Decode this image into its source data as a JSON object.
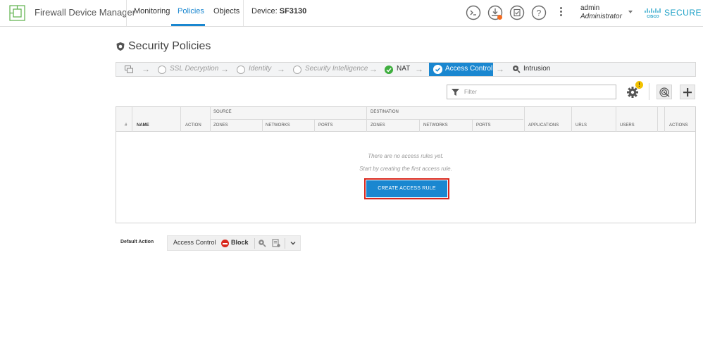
{
  "app": {
    "title": "Firewall Device Manager"
  },
  "nav": {
    "tabs": [
      {
        "label": "Monitoring"
      },
      {
        "label": "Policies"
      },
      {
        "label": "Objects"
      }
    ],
    "active_tab": "Policies",
    "device_prefix": "Device:",
    "device_name": "SF3130"
  },
  "top_icons": [
    "cli-console-icon",
    "deploy-icon",
    "task-list-icon",
    "help-icon",
    "more-options-icon"
  ],
  "user": {
    "name": "admin",
    "role": "Administrator"
  },
  "brand": {
    "secure_text": "SECURE",
    "secure_color": "#1a9fc6"
  },
  "page": {
    "title": "Security Policies"
  },
  "policy_steps": [
    {
      "label": "SSL Decryption",
      "status": "not-configured"
    },
    {
      "label": "Identity",
      "status": "not-configured"
    },
    {
      "label": "Security Intelligence",
      "status": "not-configured"
    },
    {
      "label": "NAT",
      "status": "configured"
    },
    {
      "label": "Access Control",
      "status": "active"
    },
    {
      "label": "Intrusion",
      "status": "available"
    }
  ],
  "filter": {
    "placeholder": "Filter"
  },
  "toolbar": {
    "settings_badge": "!"
  },
  "table": {
    "group_headers": {
      "source": "SOURCE",
      "destination": "DESTINATION"
    },
    "columns": {
      "number": "#",
      "name": "NAME",
      "action": "ACTION",
      "src_zones": "ZONES",
      "src_networks": "NETWORKS",
      "src_ports": "PORTS",
      "dst_zones": "ZONES",
      "dst_networks": "NETWORKS",
      "dst_ports": "PORTS",
      "applications": "APPLICATIONS",
      "urls": "URLS",
      "users": "USERS",
      "actions": "ACTIONS"
    },
    "rows": [],
    "empty_message": "There are no access rules yet.",
    "empty_hint": "Start by creating the first access rule.",
    "create_button": "CREATE ACCESS RULE"
  },
  "default_action": {
    "label": "Default Action",
    "policy": "Access Control",
    "action": "Block"
  },
  "colors": {
    "accent": "#1a87d0",
    "success": "#3fae3f",
    "block": "#d9261c",
    "highlight_outline": "#d9261c",
    "badge": "#f2c200"
  }
}
